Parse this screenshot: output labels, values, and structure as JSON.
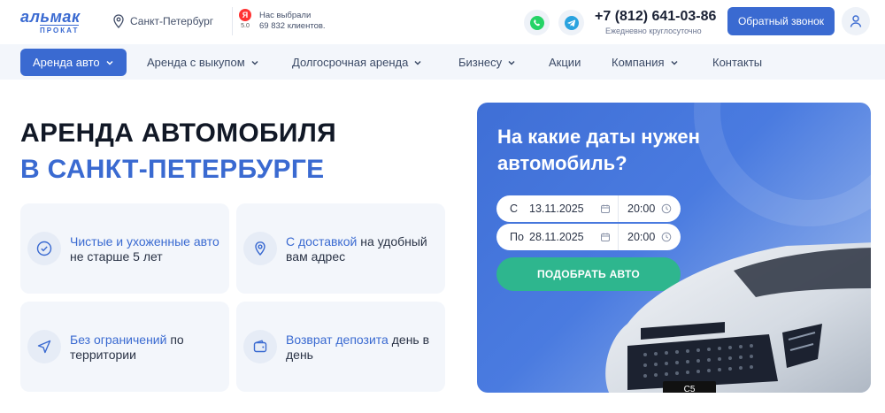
{
  "header": {
    "logo_main": "альмак",
    "logo_sub": "ПРОКАТ",
    "city": "Санкт-Петербург",
    "yandex_letter": "Я",
    "yandex_score": "5.0",
    "rating_line1": "Нас выбрали",
    "rating_line2": "69 832 клиентов.",
    "phone": "+7 (812) 641-03-86",
    "phone_note": "Ежедневно круглосуточно",
    "callback_label": "Обратный звонок"
  },
  "nav": {
    "items": [
      {
        "label": "Аренда авто",
        "dropdown": true,
        "active": true
      },
      {
        "label": "Аренда с выкупом",
        "dropdown": true
      },
      {
        "label": "Долгосрочная аренда",
        "dropdown": true
      },
      {
        "label": "Бизнесу",
        "dropdown": true
      },
      {
        "label": "Акции",
        "dropdown": false
      },
      {
        "label": "Компания",
        "dropdown": true
      },
      {
        "label": "Контакты",
        "dropdown": false
      }
    ]
  },
  "hero": {
    "title_line1": "АРЕНДА АВТОМОБИЛЯ",
    "title_line2": "В САНКТ-ПЕТЕРБУРГЕ"
  },
  "features": [
    {
      "icon": "check-icon",
      "highlight": "Чистые и ухоженные авто",
      "rest": " не старше 5 лет"
    },
    {
      "icon": "map-pin-icon",
      "highlight": "С доставкой",
      "rest": " на удобный вам адрес"
    },
    {
      "icon": "navigation-icon",
      "highlight": "Без ограничений",
      "rest": " по территории"
    },
    {
      "icon": "wallet-icon",
      "highlight": "Возврат депозита",
      "rest": " день в день"
    }
  ],
  "booking": {
    "title": "На какие даты нужен автомобиль?",
    "from_label": "С",
    "from_date": "13.11.2025",
    "from_time": "20:00",
    "to_label": "По",
    "to_date": "28.11.2025",
    "to_time": "20:00",
    "submit_label": "ПОДОБРАТЬ АВТО",
    "car_plate": "C5"
  },
  "colors": {
    "accent": "#3a6ad1",
    "green": "#2eb68e",
    "whatsapp": "#25d366",
    "telegram": "#2aa3df"
  }
}
